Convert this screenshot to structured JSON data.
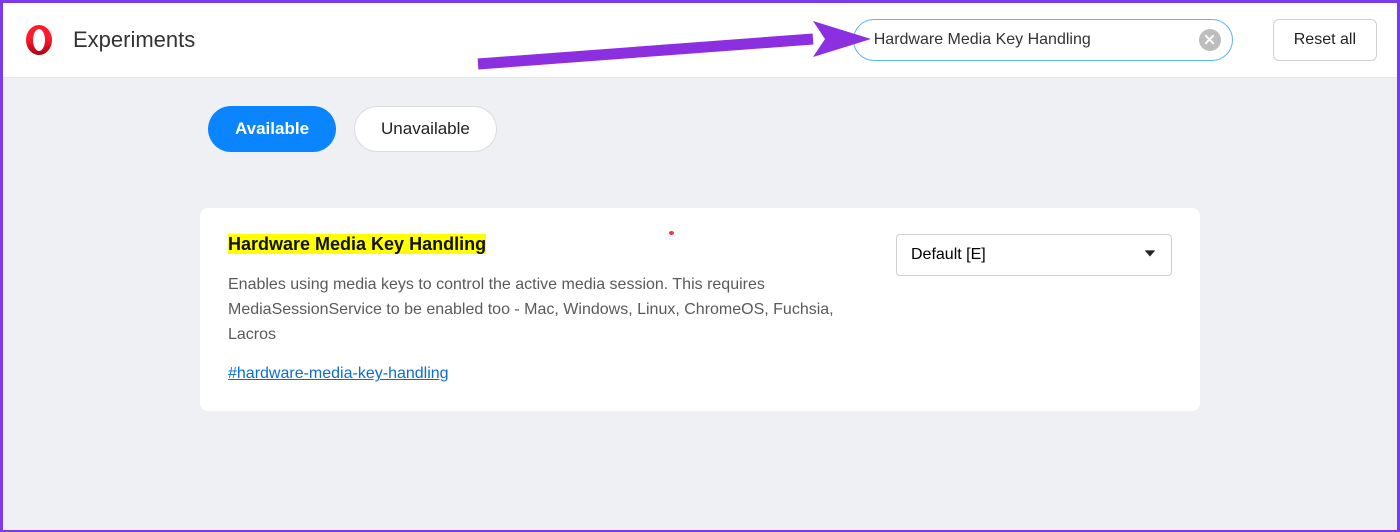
{
  "header": {
    "title": "Experiments",
    "search_value": "Hardware Media Key Handling",
    "reset_label": "Reset all"
  },
  "tabs": {
    "available": "Available",
    "unavailable": "Unavailable"
  },
  "flag": {
    "title_prefix": "Hardware Media Key Handlin",
    "title_last": "g",
    "description": "Enables using media keys to control the active media session. This requires MediaSessionService to be enabled too - Mac, Windows, Linux, ChromeOS, Fuchsia, Lacros",
    "hash_link": "#hardware-media-key-handling",
    "dropdown_value": "Default [E]"
  }
}
